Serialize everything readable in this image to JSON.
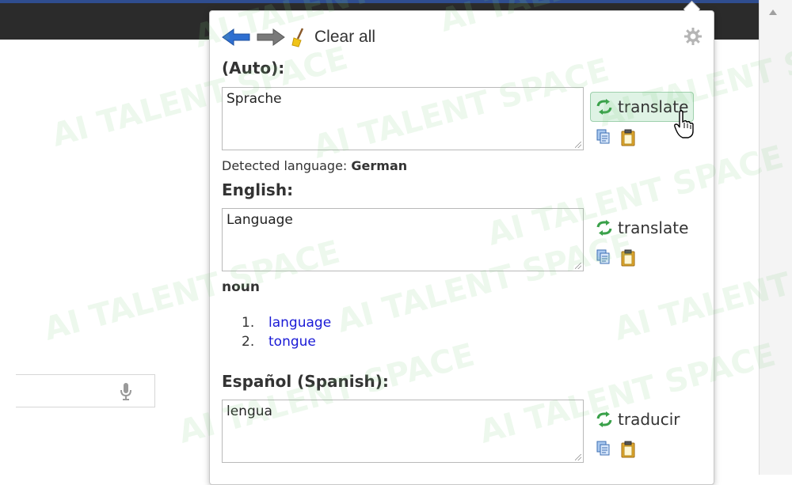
{
  "toolbar": {
    "back_icon": "back-arrow-icon",
    "forward_icon": "forward-arrow-icon",
    "clear_icon": "broom-icon",
    "clear_label": "Clear all",
    "settings_icon": "gear-icon"
  },
  "source": {
    "heading": "(Auto):",
    "text": "Sprache",
    "button_label": "translate",
    "detected_prefix": "Detected language:",
    "detected_language": "German"
  },
  "english": {
    "heading": "English:",
    "text": "Language",
    "button_label": "translate",
    "part_of_speech": "noun",
    "meanings": [
      {
        "num": "1.",
        "word": "language"
      },
      {
        "num": "2.",
        "word": "tongue"
      }
    ]
  },
  "spanish": {
    "heading": "Español (Spanish):",
    "text": "lengua",
    "button_label": "traducir"
  },
  "watermark": {
    "text": "AI TALENT SPACE"
  },
  "colors": {
    "accent_green": "#3aa14a",
    "link_blue": "#1a1ad6",
    "arrow_blue": "#2f6fd1"
  }
}
